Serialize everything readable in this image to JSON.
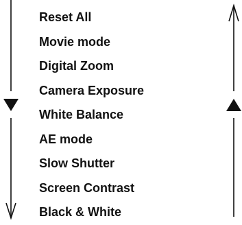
{
  "menu": {
    "items": [
      {
        "label": "Reset All"
      },
      {
        "label": "Movie mode"
      },
      {
        "label": "Digital Zoom"
      },
      {
        "label": "Camera Exposure"
      },
      {
        "label": "White Balance"
      },
      {
        "label": "AE mode"
      },
      {
        "label": "Slow Shutter"
      },
      {
        "label": "Screen Contrast"
      },
      {
        "label": "Black & White"
      }
    ],
    "selected_index": 4
  },
  "indicators": {
    "left": {
      "top_arrow": "line-arrow-down-icon",
      "marker": "solid-triangle-down-icon",
      "bottom_arrow": "line-arrow-down-icon"
    },
    "right": {
      "top_arrow": "line-arrow-up-icon",
      "marker": "solid-triangle-up-icon"
    }
  },
  "colors": {
    "foreground": "#111111",
    "background": "#ffffff"
  }
}
